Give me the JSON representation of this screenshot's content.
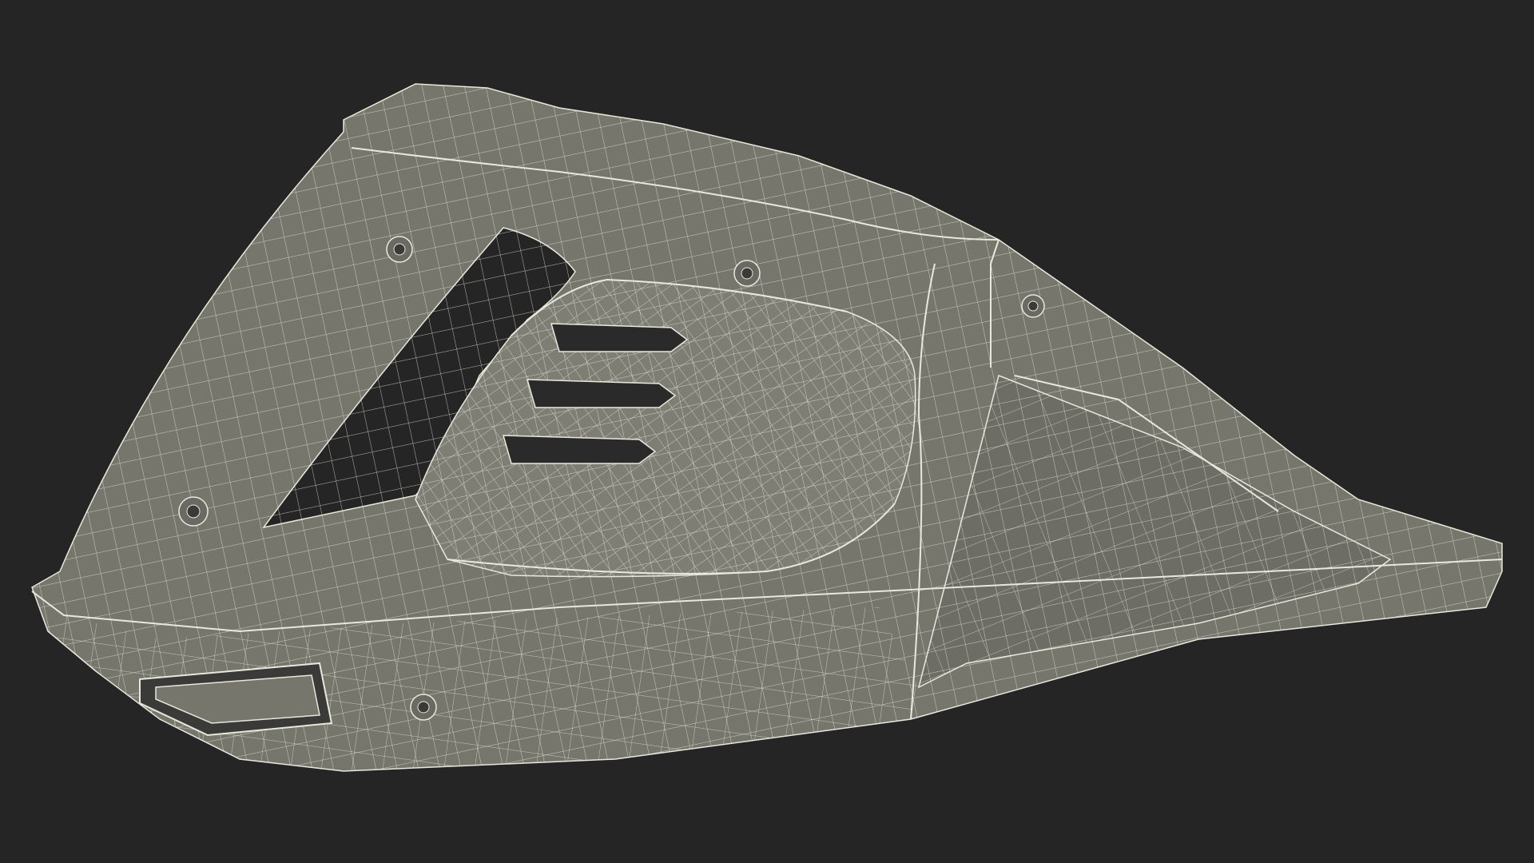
{
  "scene": {
    "subject": "handheld-vacuum-wireframe",
    "colors": {
      "background": "#252525",
      "surface": "#76766d",
      "surface_dark": "#666660",
      "surface_light": "#85857b",
      "wire": "#e8e8dc",
      "hole": "#252525"
    }
  }
}
